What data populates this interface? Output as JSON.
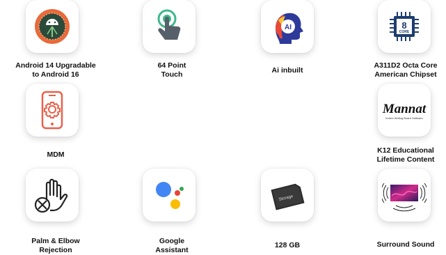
{
  "features": [
    {
      "id": "android",
      "label": "Android 14 Upgradable\nto Android 16",
      "icon": "android-logo-icon"
    },
    {
      "id": "touch",
      "label": "64 Point\nTouch",
      "icon": "touch-hand-icon"
    },
    {
      "id": "ai",
      "label": "Ai inbuilt",
      "icon": "ai-head-icon",
      "icon_text": "AI"
    },
    {
      "id": "chipset",
      "label": "A311D2 Octa Core\nAmerican Chipset",
      "icon": "cpu-chip-icon",
      "icon_text": "8",
      "icon_subtext": "CORE"
    },
    {
      "id": "mdm",
      "label": "MDM",
      "icon": "phone-gear-icon"
    },
    {
      "id": "mannat",
      "label": "K12 Educational\nLifetime Content",
      "icon": "mannat-logo-icon",
      "icon_text": "Mannat",
      "icon_subtext": "India's Writing Board Software"
    },
    {
      "id": "palm",
      "label": "Palm & Elbow\nRejection",
      "icon": "palm-rejection-icon"
    },
    {
      "id": "assistant",
      "label": "Google\nAssistant",
      "icon": "google-assistant-icon"
    },
    {
      "id": "storage",
      "label": "128 GB",
      "icon": "sd-card-icon",
      "icon_text": "Storage"
    },
    {
      "id": "sound",
      "label": "Surround Sound",
      "icon": "speaker-screen-icon"
    }
  ]
}
